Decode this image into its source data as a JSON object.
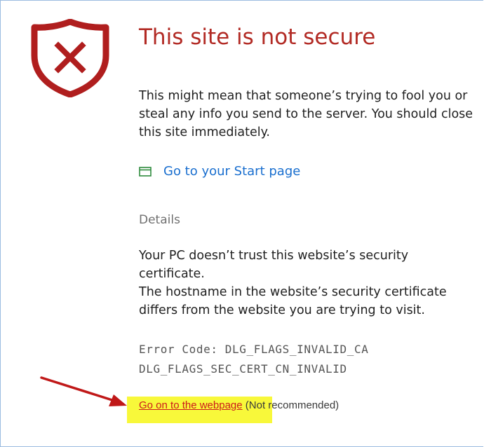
{
  "page": {
    "title": "This site is not secure",
    "warning_text": "This might mean that someone’s trying to fool you or steal any info you send to the server. You should close this site immediately.",
    "start_link": "Go to your Start page",
    "details_label": "Details",
    "details_line1": "Your PC doesn’t trust this website’s security certificate.",
    "details_line2": "The hostname in the website’s security certificate differs from the website you are trying to visit.",
    "error_line1": "Error Code: DLG_FLAGS_INVALID_CA",
    "error_line2": "DLG_FLAGS_SEC_CERT_CN_INVALID",
    "continue_link": "Go on to the webpage",
    "continue_note": " (Not recommended)"
  },
  "icons": {
    "shield": "shield-x-icon",
    "start_page": "window-icon",
    "annotation": "red-arrow-icon"
  },
  "colors": {
    "title": "#b22a24",
    "shield": "#b01e1e",
    "link": "#1a6fcf",
    "continue_link": "#cc1b1b",
    "highlight": "#f8f83a",
    "start_icon": "#2e8b3d"
  }
}
